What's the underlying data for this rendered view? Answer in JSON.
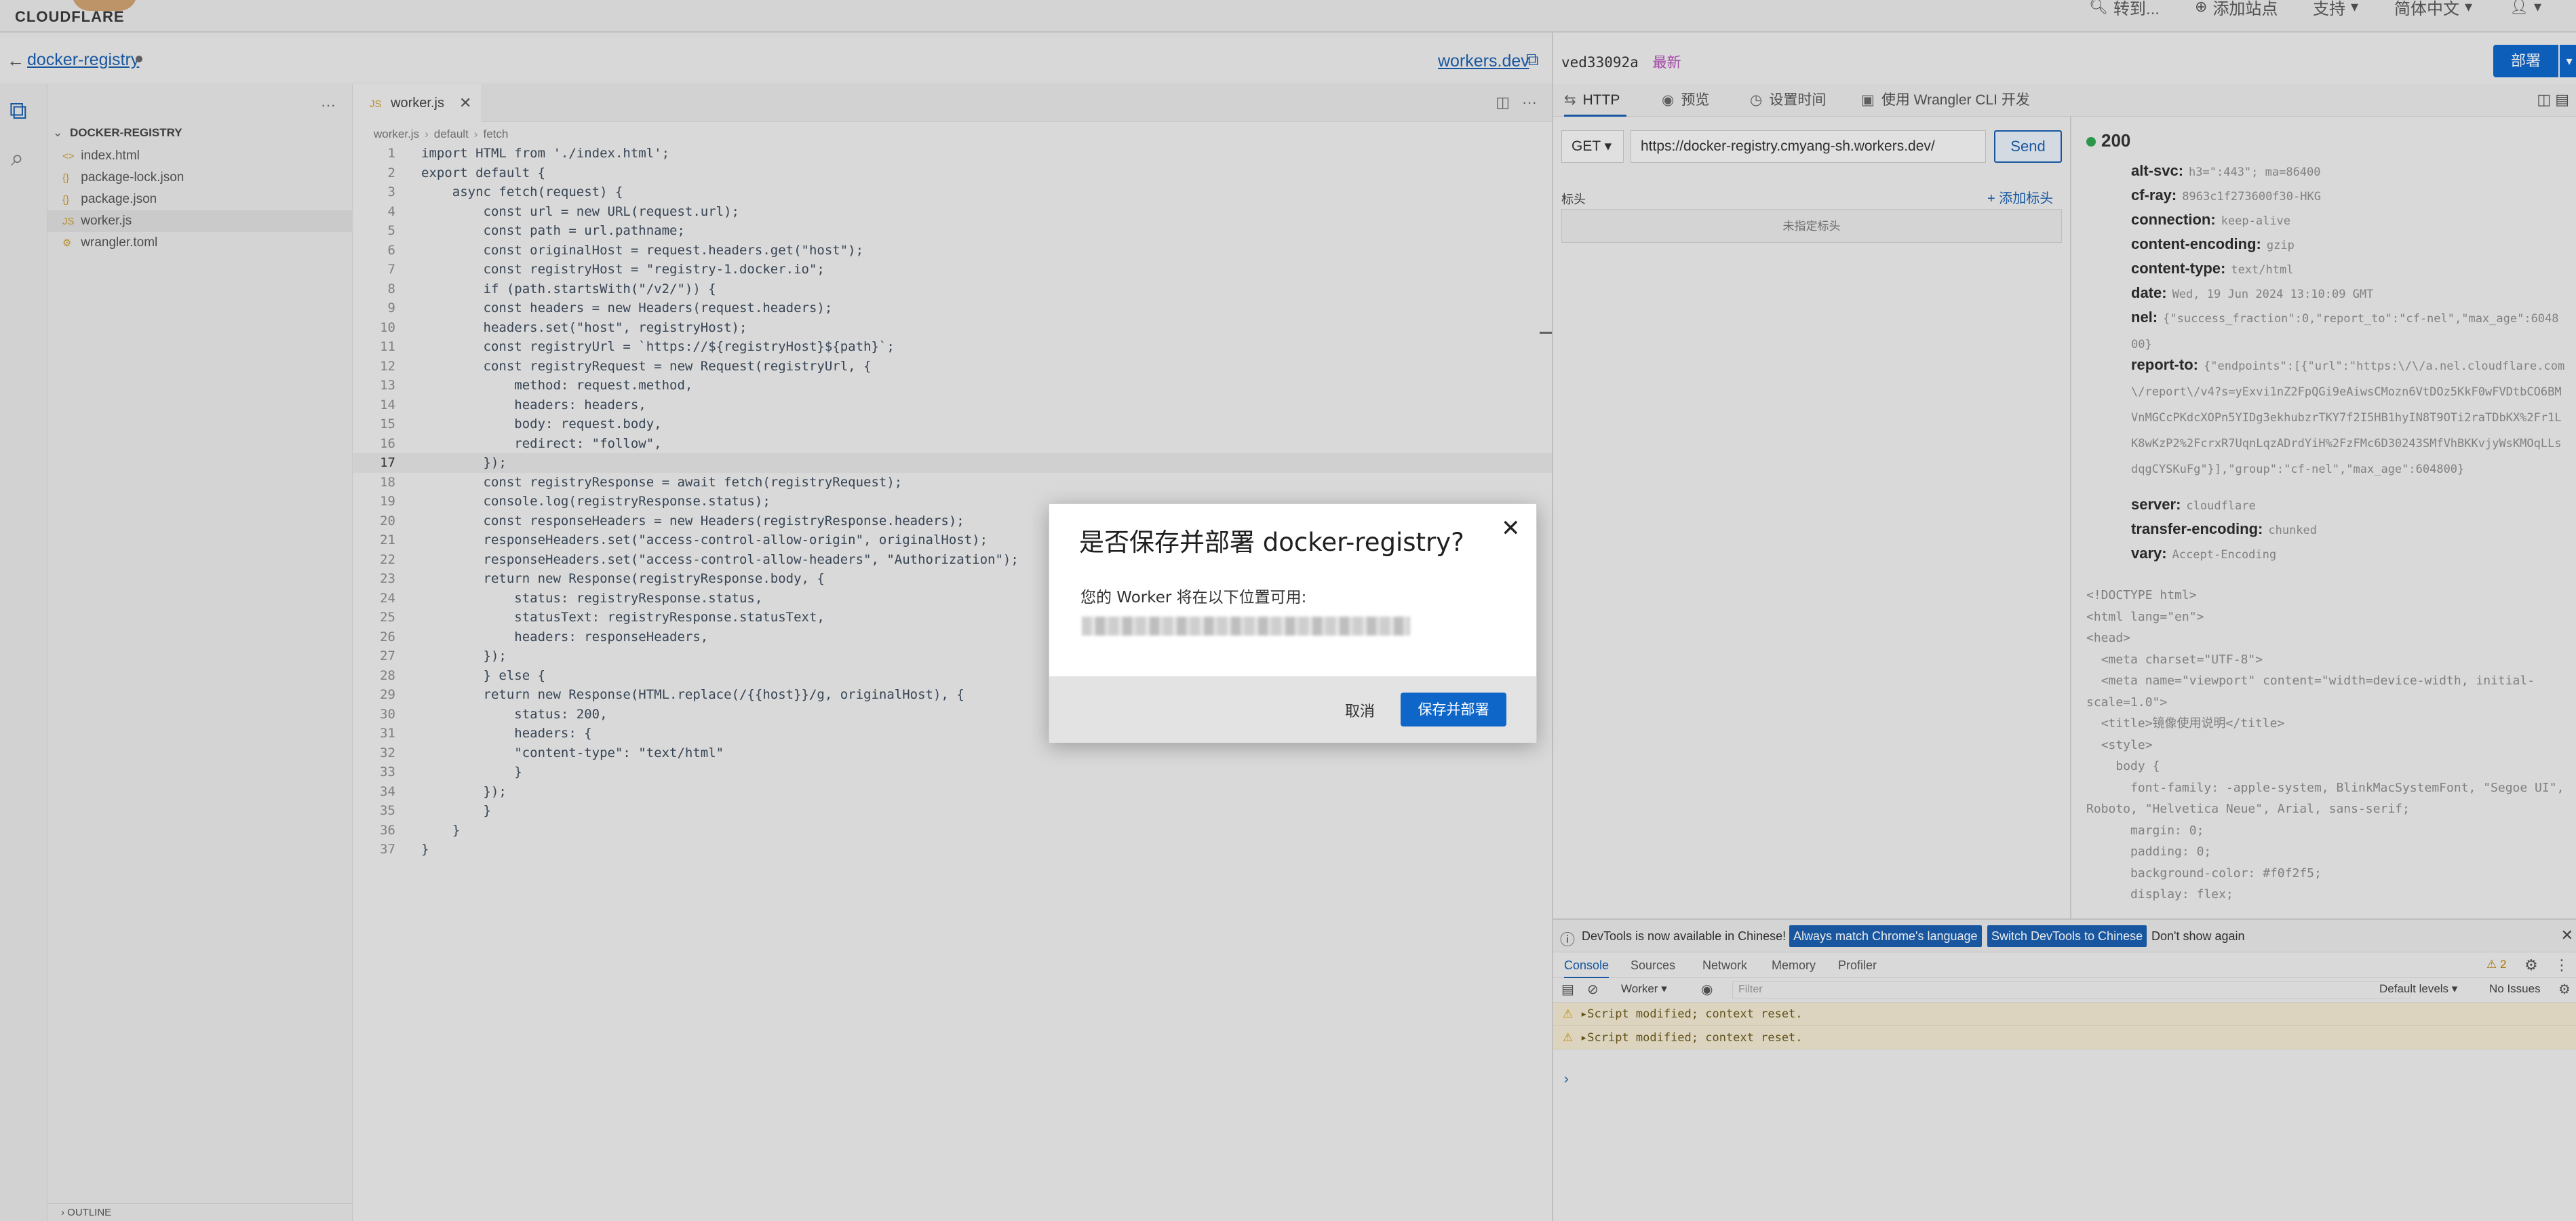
{
  "topbar": {
    "logo_text": "CLOUDFLARE",
    "go_to": "转到...",
    "add_site": "添加站点",
    "support": "支持",
    "language": "简体中文"
  },
  "editor_header": {
    "project_name": "docker-registry",
    "workers_dev": "workers.dev"
  },
  "explorer": {
    "folder": "DOCKER-REGISTRY",
    "files": [
      {
        "name": "index.html",
        "icon": "<>"
      },
      {
        "name": "package-lock.json",
        "icon": "{}"
      },
      {
        "name": "package.json",
        "icon": "{}"
      },
      {
        "name": "worker.js",
        "icon": "JS"
      },
      {
        "name": "wrangler.toml",
        "icon": "⚙"
      }
    ],
    "outline": "OUTLINE"
  },
  "editor": {
    "tab": "worker.js",
    "breadcrumb": [
      "worker.js",
      "default",
      "fetch"
    ],
    "lines": [
      "import HTML from './index.html';",
      "export default {",
      "    async fetch(request) {",
      "        const url = new URL(request.url);",
      "        const path = url.pathname;",
      "        const originalHost = request.headers.get(\"host\");",
      "        const registryHost = \"registry-1.docker.io\";",
      "        if (path.startsWith(\"/v2/\")) {",
      "        const headers = new Headers(request.headers);",
      "        headers.set(\"host\", registryHost);",
      "        const registryUrl = `https://${registryHost}${path}`;",
      "        const registryRequest = new Request(registryUrl, {",
      "            method: request.method,",
      "            headers: headers,",
      "            body: request.body,",
      "            redirect: \"follow\",",
      "        });",
      "        const registryResponse = await fetch(registryRequest);",
      "        console.log(registryResponse.status);",
      "        const responseHeaders = new Headers(registryResponse.headers);",
      "        responseHeaders.set(\"access-control-allow-origin\", originalHost);",
      "        responseHeaders.set(\"access-control-allow-headers\", \"Authorization\");",
      "        return new Response(registryResponse.body, {",
      "            status: registryResponse.status,",
      "            statusText: registryResponse.statusText,",
      "            headers: responseHeaders,",
      "        });",
      "        } else {",
      "        return new Response(HTML.replace(/{{host}}/g, originalHost), {",
      "            status: 200,",
      "            headers: {",
      "            \"content-type\": \"text/html\"",
      "            }",
      "        });",
      "        }",
      "    }",
      "}"
    ],
    "current_line": 17
  },
  "right_panel": {
    "version_hash": "ved33092a",
    "version_tag": "最新",
    "deploy": "部署",
    "tabs": [
      "HTTP",
      "预览",
      "设置时间",
      "使用 Wrangler CLI 开发"
    ],
    "method": "GET",
    "url": "https://docker-registry.cmyang-sh.workers.dev/",
    "send": "Send",
    "headers_label": "标头",
    "add_header": "+ 添加标头",
    "no_headers": "未指定标头",
    "status": "200",
    "response_headers": [
      {
        "k": "alt-svc:",
        "v": "h3=\":443\"; ma=86400"
      },
      {
        "k": "cf-ray:",
        "v": "8963c1f273600f30-HKG"
      },
      {
        "k": "connection:",
        "v": "keep-alive"
      },
      {
        "k": "content-encoding:",
        "v": "gzip"
      },
      {
        "k": "content-type:",
        "v": "text/html"
      },
      {
        "k": "date:",
        "v": "Wed, 19 Jun 2024 13:10:09 GMT"
      },
      {
        "k": "nel:",
        "v": "{\"success_fraction\":0,\"report_to\":\"cf-nel\",\"max_age\":604800}"
      },
      {
        "k": "report-to:",
        "v": "{\"endpoints\":[{\"url\":\"https:\\/\\/a.nel.cloudflare.com\\/report\\/v4?s=yExvi1nZ2FpQGi9eAiwsCMozn6VtDOz5KkF0wFVDtbCO6BMVnMGCcPKdcXOPn5YIDg3ekhubzrTKY7f2I5HB1hyIN8T9OTi2raTDbKX%2Fr1LK8wKzP2%2FcrxR7UqnLqzADrdYiH%2FzFMc6D30243SMfVhBKKvjyWsKMOqLLsdqgCYSKuFg\"}],\"group\":\"cf-nel\",\"max_age\":604800}"
      },
      {
        "k": "server:",
        "v": "cloudflare"
      },
      {
        "k": "transfer-encoding:",
        "v": "chunked"
      },
      {
        "k": "vary:",
        "v": "Accept-Encoding"
      }
    ],
    "body": "<!DOCTYPE html>\n<html lang=\"en\">\n<head>\n  <meta charset=\"UTF-8\">\n  <meta name=\"viewport\" content=\"width=device-width, initial-scale=1.0\">\n  <title>镜像使用说明</title>\n  <style>\n    body {\n      font-family: -apple-system, BlinkMacSystemFont, \"Segoe UI\", Roboto, \"Helvetica Neue\", Arial, sans-serif;\n      margin: 0;\n      padding: 0;\n      background-color: #f0f2f5;\n      display: flex;"
  },
  "devtools": {
    "info": "DevTools is now available in Chinese!",
    "match_btn": "Always match Chrome's language",
    "switch_btn": "Switch DevTools to Chinese",
    "dont_show": "Don't show again",
    "tabs": [
      "Console",
      "Sources",
      "Network",
      "Memory",
      "Profiler"
    ],
    "warn_count": "2",
    "context": "Worker",
    "filter_placeholder": "Filter",
    "levels": "Default levels",
    "issues": "No Issues",
    "messages": [
      "Script modified; context reset.",
      "Script modified; context reset."
    ],
    "prompt": "›"
  },
  "modal": {
    "title": "是否保存并部署 docker-registry?",
    "description": "您的 Worker 将在以下位置可用:",
    "cancel": "取消",
    "confirm": "保存并部署"
  },
  "colors": {
    "accent": "#0f66c9",
    "link": "#1b5fae",
    "status_ok": "#2fa44f",
    "warning": "#d19a00"
  }
}
